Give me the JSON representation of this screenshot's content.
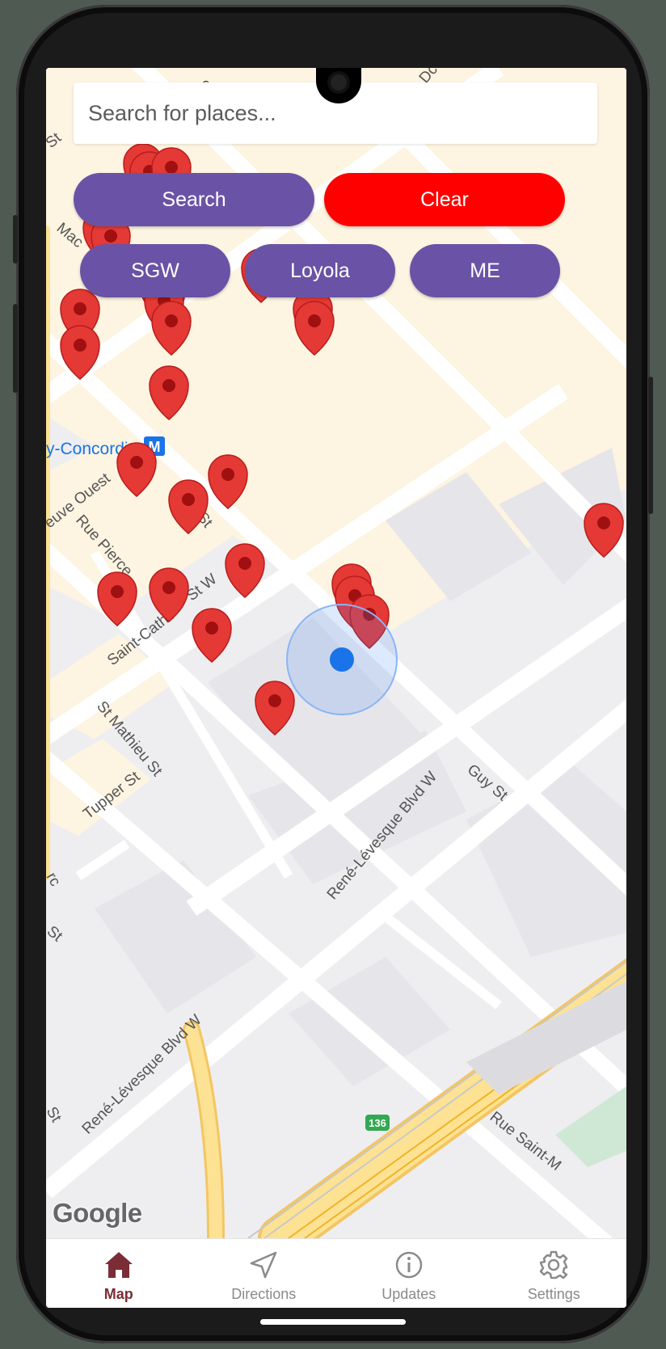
{
  "search": {
    "placeholder": "Search for places..."
  },
  "buttons": {
    "search": "Search",
    "clear": "Clear",
    "sgw": "SGW",
    "loyola": "Loyola",
    "me": "ME"
  },
  "map": {
    "street_labels": [
      "St",
      "Mac",
      "y-Concordia",
      "euve Ouest",
      "Rue Pierce",
      "St",
      "Saint-Cathe",
      "St W",
      "St Mathieu St",
      "Tupper St",
      "René-Lévesque Blvd W",
      "Guy St",
      "René-Lévesque Blvd W",
      "rc",
      "St",
      "St",
      "Rue Saint-M",
      "cre",
      "Dc"
    ],
    "metro_icon": "M",
    "highway_shield": "136",
    "attribution": "Google"
  },
  "nav": {
    "items": [
      {
        "label": "Map",
        "icon": "home-icon",
        "active": true
      },
      {
        "label": "Directions",
        "icon": "navigation-arrow-icon",
        "active": false
      },
      {
        "label": "Updates",
        "icon": "info-icon",
        "active": false
      },
      {
        "label": "Settings",
        "icon": "gear-icon",
        "active": false
      }
    ]
  },
  "colors": {
    "accent": "#6a53a6",
    "clear": "#ff0000",
    "marker": "#e53935",
    "active_tab": "#7b2d35",
    "location": "#1a73e8"
  }
}
